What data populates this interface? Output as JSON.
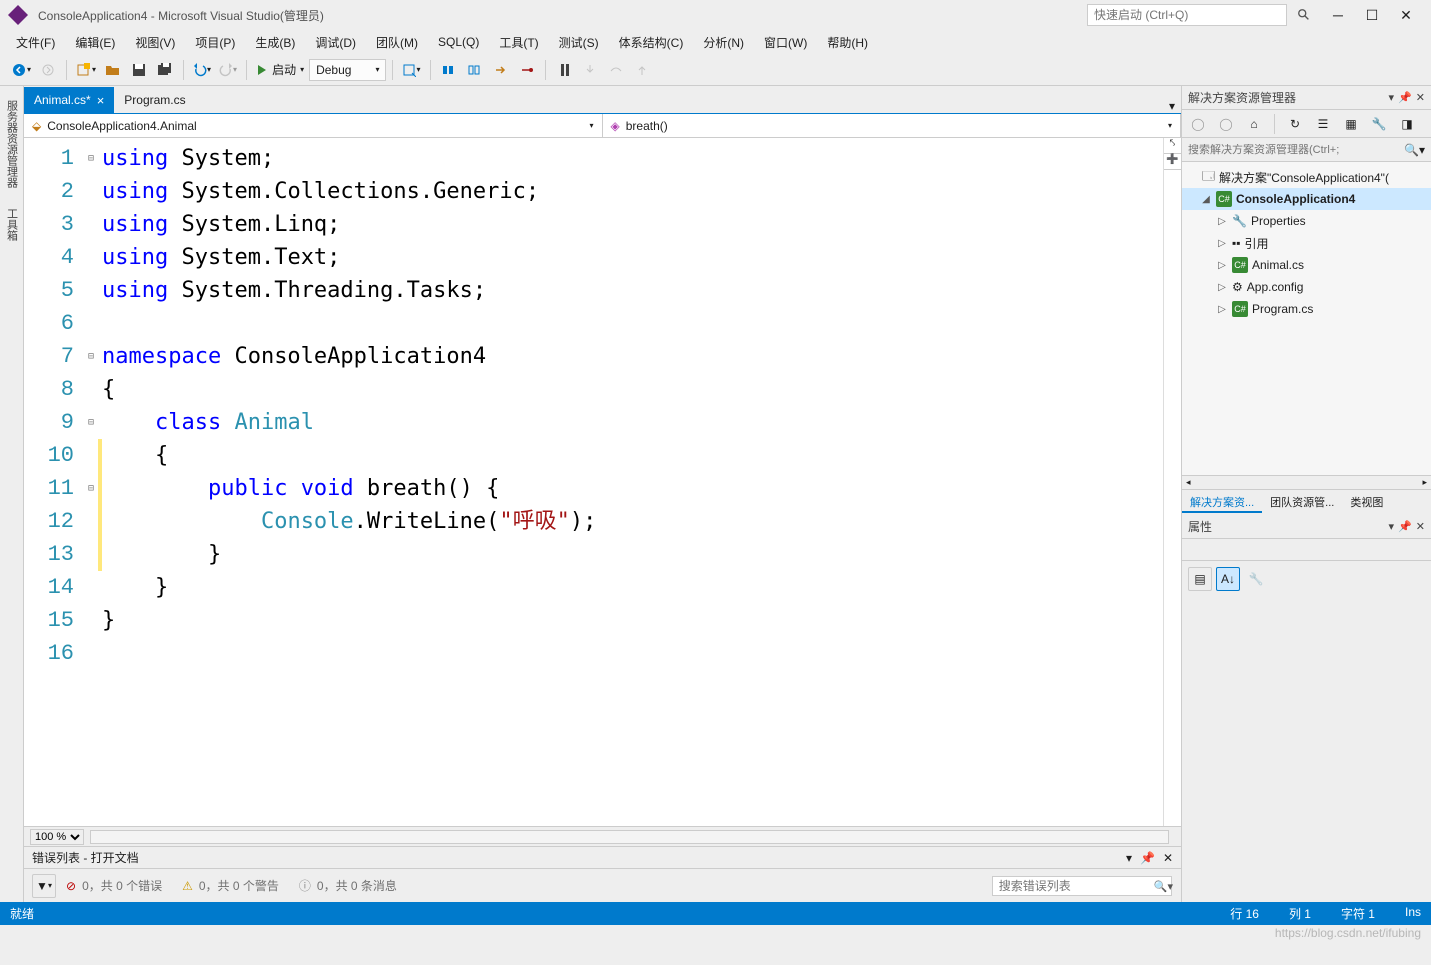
{
  "title": "ConsoleApplication4 - Microsoft Visual Studio(管理员)",
  "quick_launch_placeholder": "快速启动 (Ctrl+Q)",
  "menu": [
    "文件(F)",
    "编辑(E)",
    "视图(V)",
    "项目(P)",
    "生成(B)",
    "调试(D)",
    "团队(M)",
    "SQL(Q)",
    "工具(T)",
    "测试(S)",
    "体系结构(C)",
    "分析(N)",
    "窗口(W)",
    "帮助(H)"
  ],
  "toolbar": {
    "start": "启动",
    "config": "Debug"
  },
  "left_tabs": [
    "服务器资源管理器",
    "工具箱"
  ],
  "tabs": [
    {
      "label": "Animal.cs*",
      "active": true
    },
    {
      "label": "Program.cs",
      "active": false
    }
  ],
  "nav_left": "ConsoleApplication4.Animal",
  "nav_right": "breath()",
  "code": {
    "lines": [
      "1",
      "2",
      "3",
      "4",
      "5",
      "6",
      "7",
      "8",
      "9",
      "10",
      "11",
      "12",
      "13",
      "14",
      "15",
      "16"
    ],
    "fold": [
      "⊟",
      "",
      "",
      "",
      "",
      "",
      "⊟",
      "",
      "⊟",
      "",
      "⊟",
      "",
      "",
      "",
      "",
      ""
    ],
    "mod": [
      0,
      0,
      0,
      0,
      0,
      0,
      0,
      0,
      0,
      1,
      1,
      1,
      1,
      0,
      0,
      0
    ],
    "tokens": [
      [
        {
          "t": "using ",
          "c": "kw"
        },
        {
          "t": "System;",
          "c": ""
        }
      ],
      [
        {
          "t": "using ",
          "c": "kw"
        },
        {
          "t": "System.Collections.Generic;",
          "c": ""
        }
      ],
      [
        {
          "t": "using ",
          "c": "kw"
        },
        {
          "t": "System.Linq;",
          "c": ""
        }
      ],
      [
        {
          "t": "using ",
          "c": "kw"
        },
        {
          "t": "System.Text;",
          "c": ""
        }
      ],
      [
        {
          "t": "using ",
          "c": "kw"
        },
        {
          "t": "System.Threading.Tasks;",
          "c": ""
        }
      ],
      [],
      [
        {
          "t": "namespace ",
          "c": "kw"
        },
        {
          "t": "ConsoleApplication4",
          "c": ""
        }
      ],
      [
        {
          "t": "{",
          "c": ""
        }
      ],
      [
        {
          "t": "    ",
          "c": ""
        },
        {
          "t": "class ",
          "c": "kw"
        },
        {
          "t": "Animal",
          "c": "type"
        }
      ],
      [
        {
          "t": "    {",
          "c": ""
        }
      ],
      [
        {
          "t": "        ",
          "c": ""
        },
        {
          "t": "public ",
          "c": "kw"
        },
        {
          "t": "void ",
          "c": "kw"
        },
        {
          "t": "breath() {",
          "c": ""
        }
      ],
      [
        {
          "t": "            ",
          "c": ""
        },
        {
          "t": "Console",
          "c": "type"
        },
        {
          "t": ".WriteLine(",
          "c": ""
        },
        {
          "t": "\"呼吸\"",
          "c": "str"
        },
        {
          "t": ");",
          "c": ""
        }
      ],
      [
        {
          "t": "        }",
          "c": ""
        }
      ],
      [
        {
          "t": "    }",
          "c": ""
        }
      ],
      [
        {
          "t": "}",
          "c": ""
        }
      ],
      []
    ]
  },
  "zoom": "100 %",
  "solution": {
    "title": "解决方案资源管理器",
    "search_placeholder": "搜索解决方案资源管理器(Ctrl+;",
    "root": "解决方案\"ConsoleApplication4\"(",
    "items": [
      {
        "label": "ConsoleApplication4",
        "bold": true,
        "indent": 1,
        "expanded": true,
        "icon": "cs"
      },
      {
        "label": "Properties",
        "indent": 2,
        "icon": "wrench"
      },
      {
        "label": "引用",
        "indent": 2,
        "icon": "ref"
      },
      {
        "label": "Animal.cs",
        "indent": 2,
        "icon": "cs"
      },
      {
        "label": "App.config",
        "indent": 2,
        "icon": "cfg"
      },
      {
        "label": "Program.cs",
        "indent": 2,
        "icon": "cs"
      }
    ],
    "tabs": [
      "解决方案资...",
      "团队资源管...",
      "类视图"
    ]
  },
  "properties_title": "属性",
  "error_list": {
    "title": "错误列表 - 打开文档",
    "errors": "0，共 0 个错误",
    "warnings": "0，共 0 个警告",
    "messages": "0，共 0 条消息",
    "search_placeholder": "搜索错误列表"
  },
  "status": {
    "ready": "就绪",
    "line": "行 16",
    "col": "列 1",
    "char": "字符 1",
    "ins": "Ins"
  },
  "watermark": "https://blog.csdn.net/ifubing"
}
